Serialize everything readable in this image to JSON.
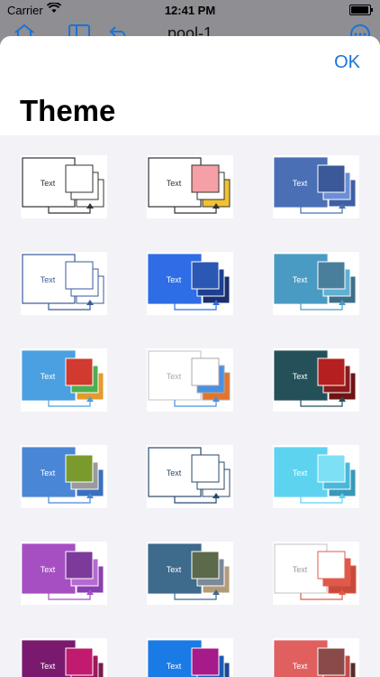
{
  "status_bar": {
    "carrier": "Carrier",
    "time": "12:41 PM"
  },
  "background_nav": {
    "title": "pool-1"
  },
  "sheet": {
    "ok_label": "OK",
    "title": "Theme"
  },
  "thumb_text": "Text",
  "themes": [
    {
      "main_fill": "#ffffff",
      "main_stroke": "#333333",
      "a": "#ffffff",
      "b": "#ffffff",
      "c": "#ffffff",
      "stroke": "#333333",
      "text": "#333333",
      "arrow": "#333333"
    },
    {
      "main_fill": "#ffffff",
      "main_stroke": "#333333",
      "a": "#f4a0a6",
      "b": "#ffffff",
      "c": "#f1c232",
      "stroke": "#333333",
      "text": "#333333",
      "arrow": "#333333"
    },
    {
      "main_fill": "#4a6fb5",
      "main_stroke": "#4a6fb5",
      "a": "#3b5998",
      "b": "#6b8ed6",
      "c": "#3f5fa5",
      "stroke": "#ffffff",
      "text": "#ffffff",
      "arrow": "#4a6fb5"
    },
    {
      "main_fill": "#ffffff",
      "main_stroke": "#3a5a9c",
      "a": "#ffffff",
      "b": "#ffffff",
      "c": "#ffffff",
      "stroke": "#3a5a9c",
      "text": "#3a5a9c",
      "arrow": "#3a5a9c"
    },
    {
      "main_fill": "#2e6de6",
      "main_stroke": "#2e6de6",
      "a": "#2b57b5",
      "b": "#1d3f8f",
      "c": "#1a2f6e",
      "stroke": "#ffffff",
      "text": "#ffffff",
      "arrow": "#2e6de6"
    },
    {
      "main_fill": "#4a9bc4",
      "main_stroke": "#4a9bc4",
      "a": "#4a7f9c",
      "b": "#5fb0d3",
      "c": "#3d6f88",
      "stroke": "#ffffff",
      "text": "#ffffff",
      "arrow": "#4a9bc4"
    },
    {
      "main_fill": "#4aa0e0",
      "main_stroke": "#4aa0e0",
      "a": "#d13a2e",
      "b": "#4caf50",
      "c": "#e59a2b",
      "stroke": "#ffffff",
      "text": "#ffffff",
      "arrow": "#4aa0e0"
    },
    {
      "main_fill": "#ffffff",
      "main_stroke": "#cccccc",
      "a": "#ffffff",
      "b": "#4a90e2",
      "c": "#e5742b",
      "stroke": "#aaaaaa",
      "text": "#aaaaaa",
      "arrow": "#4a90e2"
    },
    {
      "main_fill": "#24505a",
      "main_stroke": "#24505a",
      "a": "#b51f1f",
      "b": "#8c1a1a",
      "c": "#6e1414",
      "stroke": "#ffffff",
      "text": "#ffffff",
      "arrow": "#24505a"
    },
    {
      "main_fill": "#4a86d6",
      "main_stroke": "#4a86d6",
      "a": "#7a9a2e",
      "b": "#9a9a9a",
      "c": "#3a6fc0",
      "stroke": "#ffffff",
      "text": "#ffffff",
      "arrow": "#4a86d6"
    },
    {
      "main_fill": "#ffffff",
      "main_stroke": "#2a4a6a",
      "a": "#ffffff",
      "b": "#ffffff",
      "c": "#ffffff",
      "stroke": "#2a4a6a",
      "text": "#2a4a6a",
      "arrow": "#2a4a6a"
    },
    {
      "main_fill": "#5ed3f0",
      "main_stroke": "#5ed3f0",
      "a": "#7ee0f5",
      "b": "#4ab8d8",
      "c": "#3a98b8",
      "stroke": "#ffffff",
      "text": "#ffffff",
      "arrow": "#5ed3f0"
    },
    {
      "main_fill": "#a64fc2",
      "main_stroke": "#a64fc2",
      "a": "#7d3a9a",
      "b": "#b56ad1",
      "c": "#8a3fb0",
      "stroke": "#ffffff",
      "text": "#ffffff",
      "arrow": "#a64fc2"
    },
    {
      "main_fill": "#3e6a8c",
      "main_stroke": "#3e6a8c",
      "a": "#5a6a4a",
      "b": "#7a8a9a",
      "c": "#b59a7a",
      "stroke": "#ffffff",
      "text": "#ffffff",
      "arrow": "#3e6a8c"
    },
    {
      "main_fill": "#ffffff",
      "main_stroke": "#cccccc",
      "a": "#ffffff",
      "b": "#e05a4a",
      "c": "#c84a3a",
      "stroke": "#e05a4a",
      "text": "#999999",
      "arrow": "#e05a4a"
    },
    {
      "main_fill": "#7a1a6e",
      "main_stroke": "#7a1a6e",
      "a": "#c21a6e",
      "b": "#9a1a5a",
      "c": "#7a1a4a",
      "stroke": "#ffffff",
      "text": "#ffffff",
      "arrow": "#7a1a6e"
    },
    {
      "main_fill": "#1a7ae6",
      "main_stroke": "#1a7ae6",
      "a": "#a61a8a",
      "b": "#1a5ab5",
      "c": "#1a4a95",
      "stroke": "#ffffff",
      "text": "#ffffff",
      "arrow": "#1a7ae6"
    },
    {
      "main_fill": "#e06060",
      "main_stroke": "#e06060",
      "a": "#8a4a4a",
      "b": "#c24a4a",
      "c": "#5a2a2a",
      "stroke": "#ffffff",
      "text": "#ffffff",
      "arrow": "#e06060"
    }
  ]
}
